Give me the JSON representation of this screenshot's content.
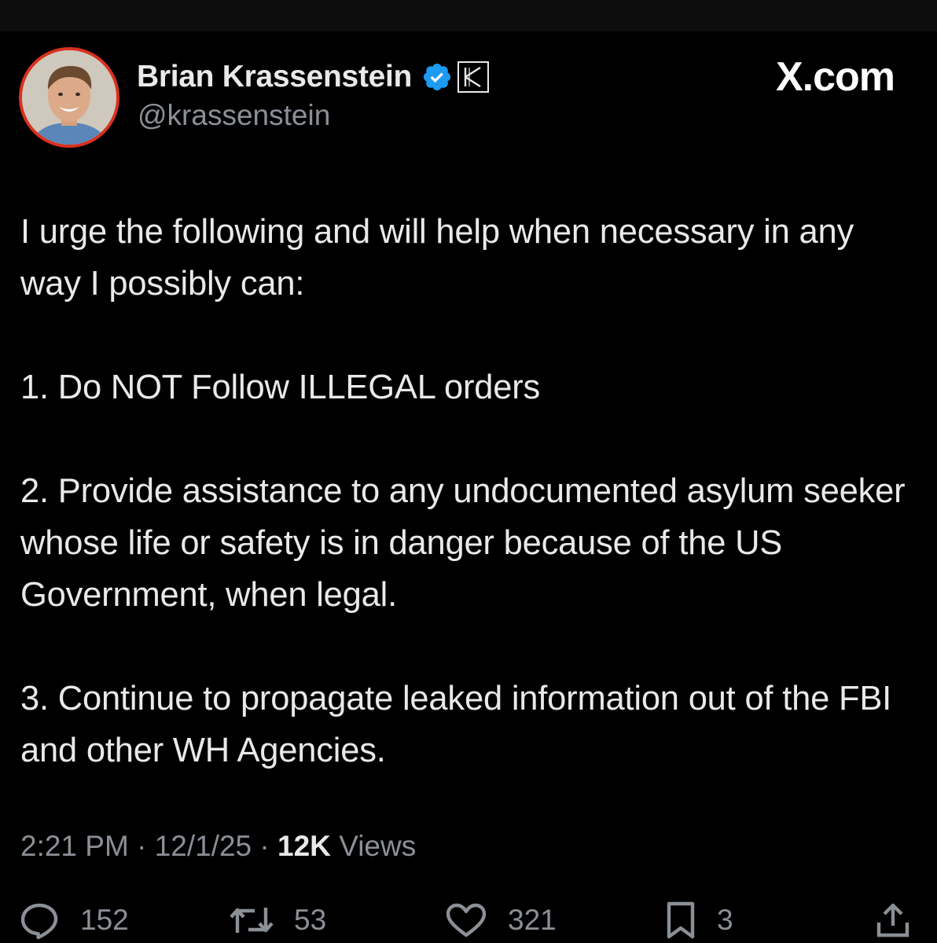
{
  "author": {
    "display_name": "Brian Krassenstein",
    "handle": "@krassenstein",
    "badge_letter": "K",
    "avatar_icon": "profile-photo"
  },
  "brand": {
    "label": "X.com"
  },
  "tweet": {
    "paragraphs": [
      "I urge the following and will help when necessary in any way I possibly can:",
      "1. Do NOT Follow ILLEGAL orders",
      "2. Provide assistance to any undocumented asylum seeker whose life or safety is in danger because of the US Government, when legal.",
      "3. Continue to propagate leaked information out of the FBI and other WH Agencies."
    ]
  },
  "meta": {
    "time": "2:21 PM",
    "date": "12/1/25",
    "views_count": "12K",
    "views_label": "Views",
    "separator": "·"
  },
  "actions": {
    "replies": "152",
    "reposts": "53",
    "likes": "321",
    "bookmarks": "3"
  },
  "colors": {
    "background": "#000000",
    "text": "#e7e9ea",
    "muted": "#8b9097",
    "verified": "#1d9bf0",
    "avatar_ring": "#d8311f"
  },
  "icons": [
    "verified-icon",
    "affiliate-badge-icon",
    "reply-icon",
    "repost-icon",
    "like-icon",
    "bookmark-icon",
    "share-icon"
  ]
}
